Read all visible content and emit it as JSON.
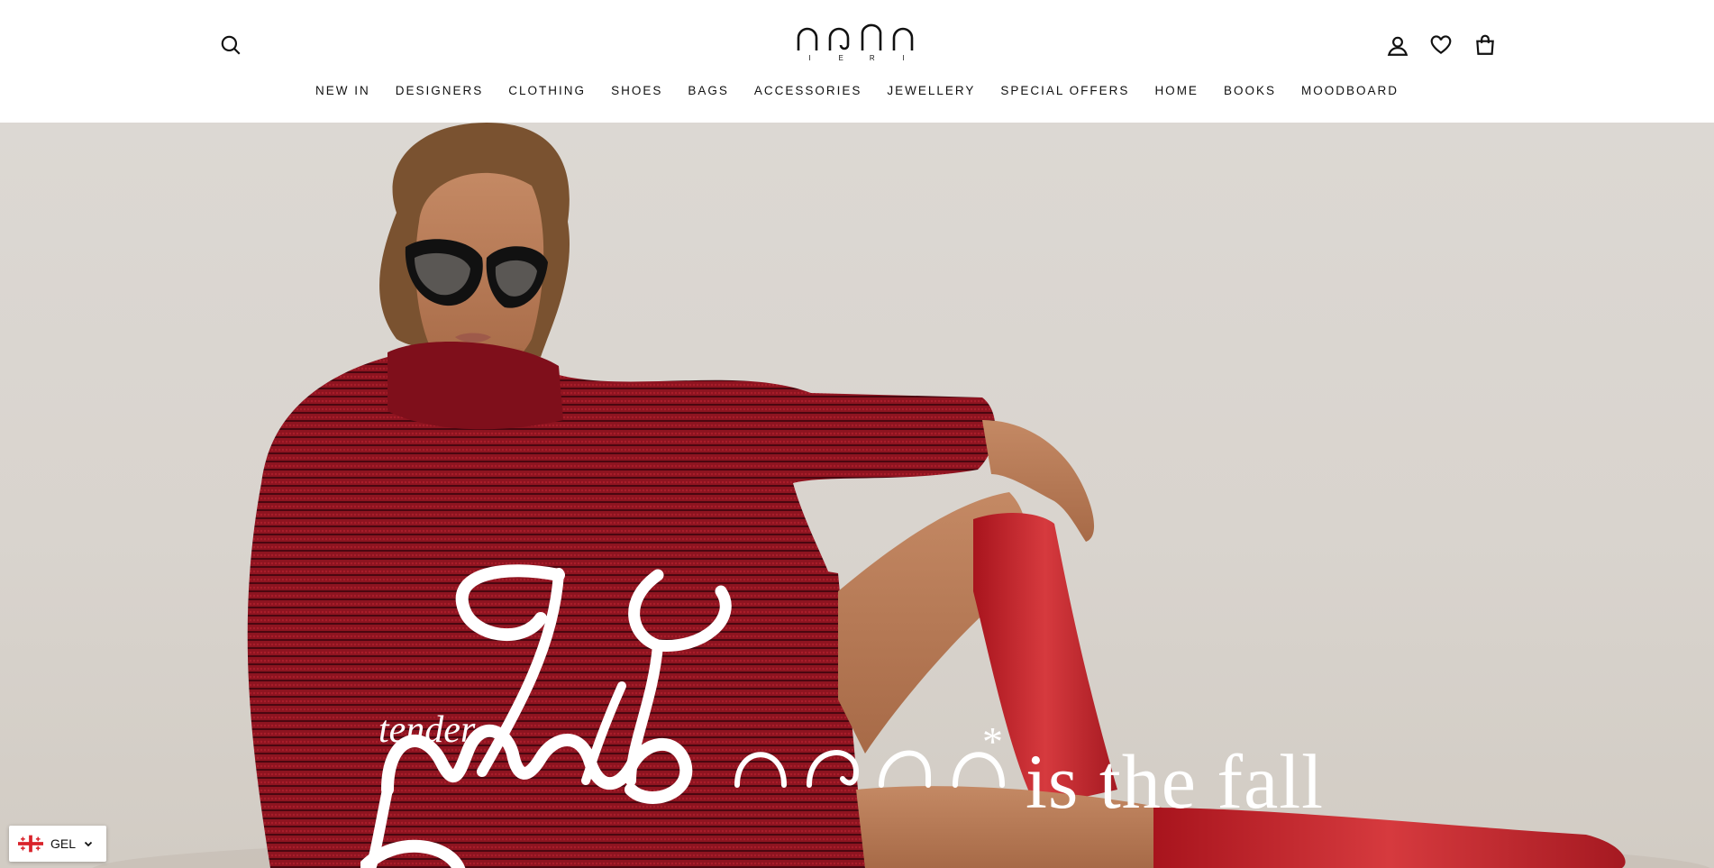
{
  "header": {
    "logo": {
      "text": "აპრი",
      "sub_letters": [
        "I",
        "E",
        "R",
        "I"
      ]
    },
    "icons": {
      "search": "search-icon",
      "account": "user-icon",
      "wishlist": "heart-icon",
      "cart": "shopping-bag-icon"
    }
  },
  "nav": {
    "items": [
      "NEW IN",
      "DESIGNERS",
      "CLOTHING",
      "SHOES",
      "BAGS",
      "ACCESSORIES",
      "JEWELLERY",
      "SPECIAL OFFERS",
      "HOME",
      "BOOKS",
      "MOODBOARD"
    ]
  },
  "hero": {
    "tender": "tender",
    "asterisk": "*",
    "tagline": "is the fall",
    "colors": {
      "sweater": "#8e1420",
      "boots": "#c8232c",
      "text": "#ffffff"
    }
  },
  "currency": {
    "code": "GEL",
    "flag_icon": "georgia-flag-icon",
    "chevron_icon": "chevron-down-icon"
  }
}
